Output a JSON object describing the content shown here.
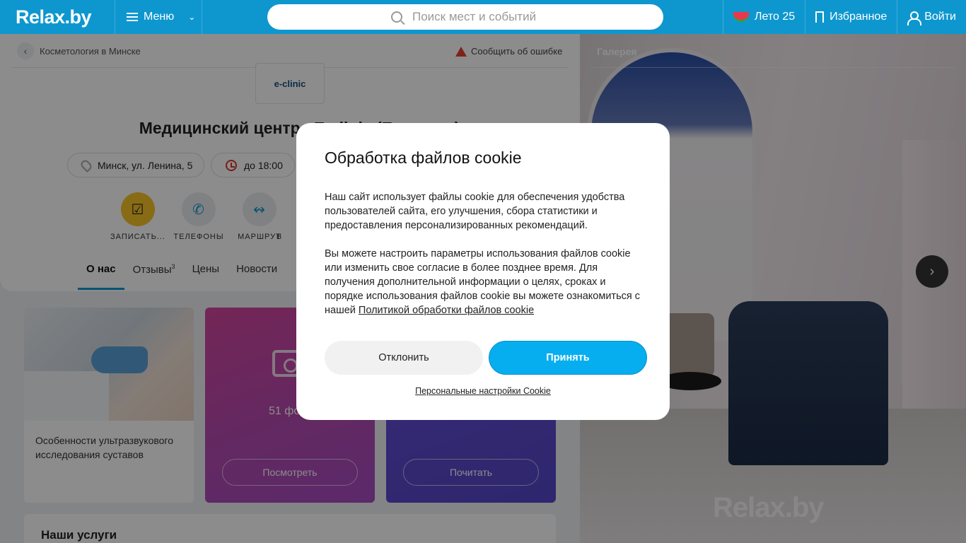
{
  "header": {
    "logo": "Relax.by",
    "menu_label": "Меню",
    "search_placeholder": "Поиск мест и событий",
    "summer_label": "Лето 25",
    "favorites_label": "Избранное",
    "login_label": "Войти"
  },
  "page": {
    "breadcrumb": "Косметология в Минске",
    "report_error": "Сообщить об ошибке",
    "clinic_logo": "e-clinic",
    "title": "Медицинский центр «E-clinic (Е-клиник)»",
    "address": "Минск, ул. Ленина, 5",
    "hours": "до 18:00",
    "actions": [
      "ЗАПИСАТЬ...",
      "ТЕЛЕФОНЫ",
      "МАРШРУТ",
      "В"
    ],
    "tabs": [
      {
        "label": "О нас",
        "count": ""
      },
      {
        "label": "Отзывы",
        "count": "3"
      },
      {
        "label": "Цены",
        "count": ""
      },
      {
        "label": "Новости",
        "count": ""
      }
    ],
    "article_title": "Особенности ультразвукового исследования суставов",
    "photo_count": "51 фото",
    "view_button": "Посмотреть",
    "read_button": "Почитать",
    "services_title": "Наши услуги"
  },
  "gallery": {
    "label": "Галерея",
    "watermark": "Relax.by"
  },
  "cookie_modal": {
    "title": "Обработка файлов cookie",
    "paragraph1": "Наш сайт использует файлы cookie для обеспечения удобства пользователей сайта, его улучшения, сбора статистики и предоставления персонализированных рекомендаций.",
    "paragraph2": "Вы можете настроить параметры использования файлов cookie или изменить свое согласие в более позднее время. Для получения дополнительной информации о целях, сроках и порядке использования файлов cookie вы можете ознакомиться с нашей",
    "policy_link": "Политикой обработки файлов cookie",
    "decline_label": "Отклонить",
    "accept_label": "Принять",
    "personal_settings": "Персональные настройки Cookie"
  }
}
